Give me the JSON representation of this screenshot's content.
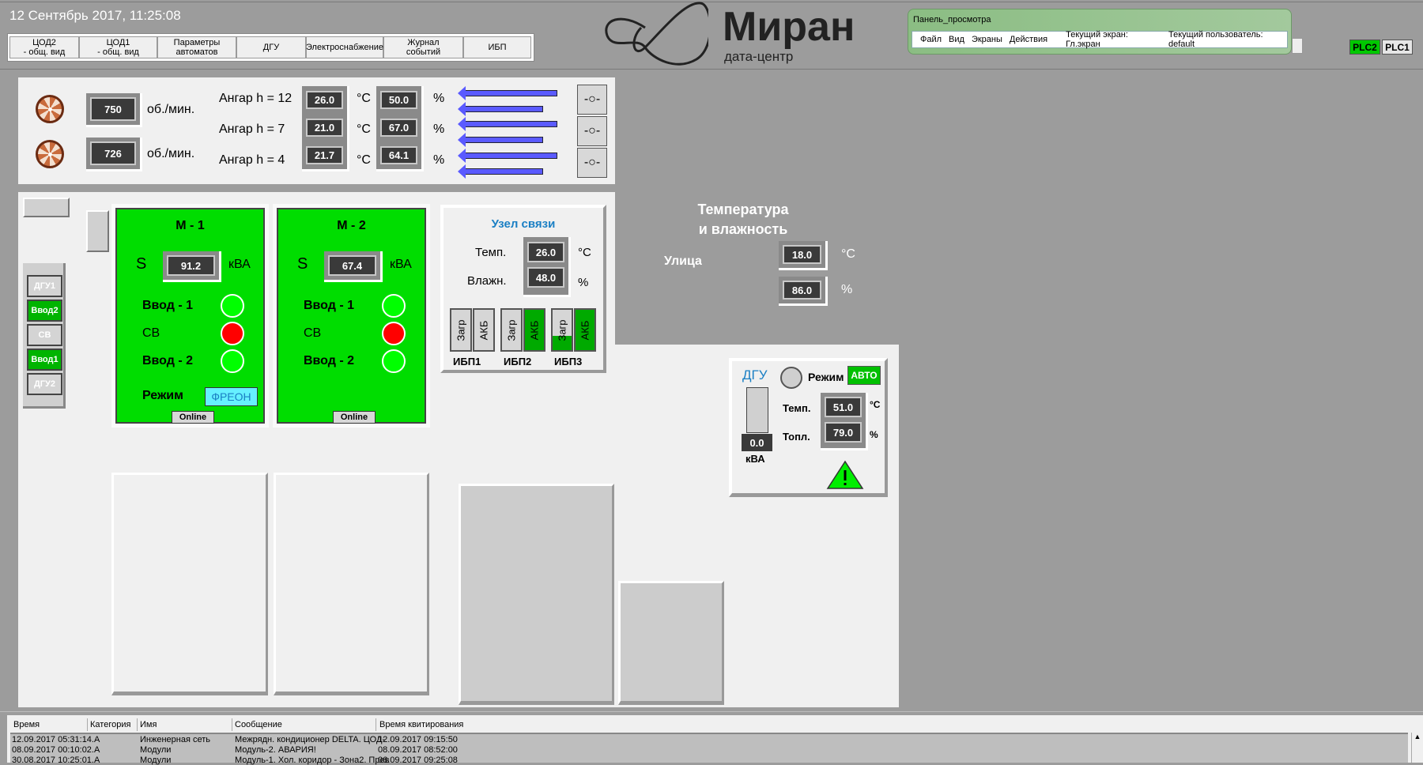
{
  "header": {
    "datetime": "12 Сентябрь 2017, 11:25:08"
  },
  "nav": [
    {
      "label": "ЦОД2\n- общ. вид"
    },
    {
      "label": "ЦОД1\n- общ. вид"
    },
    {
      "label": "Параметры\nавтоматов"
    },
    {
      "label": "ДГУ"
    },
    {
      "label": "Электроснабжение"
    },
    {
      "label": "Журнал\nсобытий"
    },
    {
      "label": "ИБП"
    }
  ],
  "logo": {
    "name": "Миран",
    "subtitle": "дата-центр"
  },
  "viewer": {
    "title": "Панель_просмотра",
    "menu": [
      "Файл",
      "Вид",
      "Экраны",
      "Действия"
    ],
    "current_screen": "Текущий экран: Гл.экран",
    "current_user": "Текущий пользователь: default"
  },
  "plc": {
    "plc2": "PLC2",
    "plc1": "PLC1"
  },
  "fans": [
    {
      "rpm": "750",
      "unit": "об./мин."
    },
    {
      "rpm": "726",
      "unit": "об./мин."
    }
  ],
  "hangar": [
    {
      "label": "Ангар h = 12",
      "temp": "26.0",
      "hum": "50.0"
    },
    {
      "label": "Ангар h = 7",
      "temp": "21.0",
      "hum": "67.0"
    },
    {
      "label": "Ангар h = 4",
      "temp": "21.7",
      "hum": "64.1"
    }
  ],
  "units": {
    "c": "°C",
    "pct": "%",
    "kva": "кВА"
  },
  "sidebar": [
    "ДГУ1",
    "Ввод2",
    "СВ",
    "Ввод1",
    "ДГУ2"
  ],
  "modules": [
    {
      "title": "М - 1",
      "s_label": "S",
      "s": "91.2",
      "in1": "Ввод - 1",
      "sv": "СВ",
      "in2": "Ввод - 2",
      "mode_label": "Режим",
      "mode": "ФРЕОН",
      "status": "Online"
    },
    {
      "title": "М - 2",
      "s_label": "S",
      "s": "67.4",
      "in1": "Ввод - 1",
      "sv": "СВ",
      "in2": "Ввод - 2",
      "status": "Online"
    }
  ],
  "node": {
    "title": "Узел связи",
    "temp_label": "Темп.",
    "temp": "26.0",
    "hum_label": "Влажн.",
    "hum": "48.0",
    "ups": [
      {
        "name": "ИБП1",
        "load": "Загр",
        "bat": "АКБ",
        "load_fill": 0,
        "bat_on": false
      },
      {
        "name": "ИБП2",
        "load": "Загр",
        "bat": "АКБ",
        "load_fill": 0,
        "bat_on": true
      },
      {
        "name": "ИБП3",
        "load": "Загр",
        "bat": "АКБ",
        "load_fill": 0.35,
        "bat_on": true
      }
    ]
  },
  "outdoor": {
    "title1": "Температура",
    "title2": "и влажность",
    "label": "Улица",
    "temp": "18.0",
    "hum": "86.0"
  },
  "dgu": {
    "title": "ДГУ",
    "mode_label": "Режим",
    "mode": "АВТО",
    "power": "0.0",
    "temp_label": "Темп.",
    "temp": "51.0",
    "fuel_label": "Топл.",
    "fuel": "79.0"
  },
  "log": {
    "columns": [
      "Время",
      "Категория",
      "Имя",
      "Сообщение",
      "Время квитирования"
    ],
    "rows": [
      [
        "12.09.2017 05:31:14.A",
        "",
        "Инженерная сеть",
        "Межрядн. кондиционер DELTA. ЦОД-",
        "12.09.2017 09:15:50"
      ],
      [
        "08.09.2017 00:10:02.A",
        "",
        "Модули",
        "Модуль-2. АВАРИЯ!",
        "08.09.2017 08:52:00"
      ],
      [
        "30.08.2017 10:25:01.A",
        "",
        "Модули",
        "Модуль-1. Хол. коридор - Зона2. Прев",
        "06.09.2017 09:25:08"
      ]
    ]
  },
  "colors": {
    "green": "#00dd00",
    "red": "#ff0000",
    "blue_arrow": "#5a5aff",
    "accent_text": "#1a7fc4"
  }
}
